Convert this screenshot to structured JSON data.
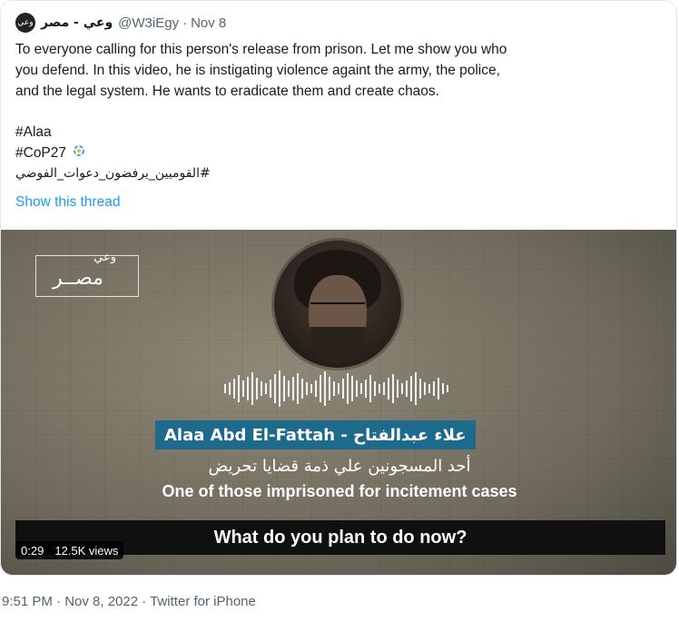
{
  "tweet": {
    "display_name": "وعي - مصر",
    "avatar_text": "وعي",
    "handle": "@W3iEgy",
    "separator": "·",
    "date": "Nov 8",
    "text_lines": [
      "To everyone calling for this person's release from prison. Let me show you who",
      "you defend. In this video, he is instigating violence againt the army, the police,",
      "and the legal system. He wants to eradicate them and create chaos."
    ],
    "hashtags": [
      "#Alaa",
      "#CoP27",
      "#القوميين_يرفضون_دعوات_الفوضي"
    ],
    "show_thread": "Show this thread"
  },
  "video": {
    "logo_top": "وعي",
    "logo_main": "مصــر",
    "name_banner": "Alaa Abd El-Fattah - علاء عبدالفتاح",
    "arabic_subtitle": "أحد المسجونين علي ذمة قضايا تحريض",
    "english_subtitle": "One of those imprisoned for incitement cases",
    "caption": "What do you plan to do now?",
    "duration": "0:29",
    "views": "12.5K views"
  },
  "footer": {
    "meta": "9:51 PM · Nov 8, 2022 · Twitter for iPhone"
  }
}
